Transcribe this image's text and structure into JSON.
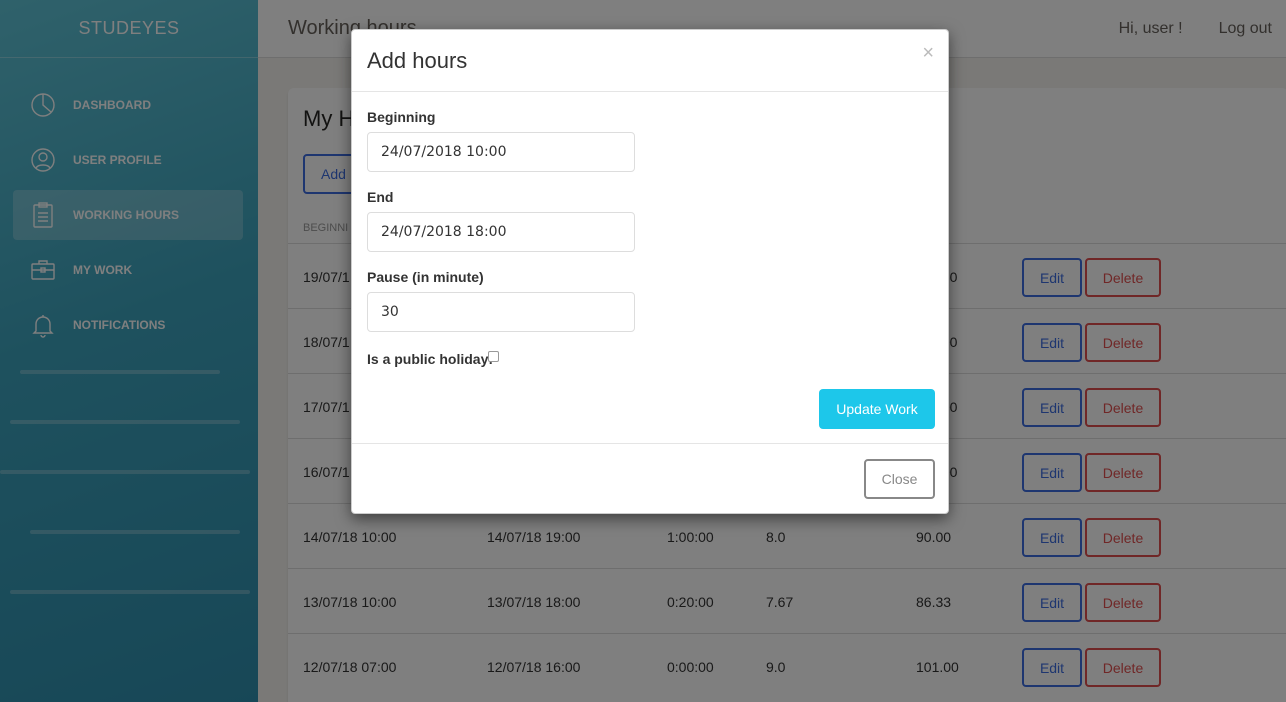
{
  "brand": "STUDEYES",
  "nav": [
    {
      "label": "DASHBOARD",
      "icon": "pie-chart-icon"
    },
    {
      "label": "USER PROFILE",
      "icon": "user-icon"
    },
    {
      "label": "WORKING HOURS",
      "icon": "clipboard-icon"
    },
    {
      "label": "MY WORK",
      "icon": "briefcase-icon"
    },
    {
      "label": "NOTIFICATIONS",
      "icon": "bell-icon"
    }
  ],
  "topbar": {
    "title": "Working hours",
    "greeting": "Hi, user !",
    "logout": "Log out"
  },
  "card": {
    "title": "My H",
    "add_label": "Add",
    "headers": [
      "BEGINNI",
      "RY"
    ],
    "rows": [
      {
        "begin": "19/07/1",
        "end": "",
        "pause": "",
        "hours": "",
        "salary": ".50"
      },
      {
        "begin": "18/07/1",
        "end": "",
        "pause": "",
        "hours": "",
        "salary": ".00"
      },
      {
        "begin": "17/07/1",
        "end": "",
        "pause": "",
        "hours": "",
        "salary": ".00"
      },
      {
        "begin": "16/07/1",
        "end": "",
        "pause": "",
        "hours": "",
        "salary": ".00"
      },
      {
        "begin": "14/07/18 10:00",
        "end": "14/07/18 19:00",
        "pause": "1:00:00",
        "hours": "8.0",
        "salary": "90.00"
      },
      {
        "begin": "13/07/18 10:00",
        "end": "13/07/18 18:00",
        "pause": "0:20:00",
        "hours": "7.67",
        "salary": "86.33"
      },
      {
        "begin": "12/07/18 07:00",
        "end": "12/07/18 16:00",
        "pause": "0:00:00",
        "hours": "9.0",
        "salary": "101.00"
      }
    ],
    "edit_label": "Edit",
    "delete_label": "Delete"
  },
  "modal": {
    "title": "Add hours",
    "close_x": "×",
    "beginning_label": "Beginning",
    "beginning_value": "24/07/2018 10:00",
    "end_label": "End",
    "end_value": "24/07/2018 18:00",
    "pause_label": "Pause (in minute)",
    "pause_value": "30",
    "holiday_label": "Is a public holiday:",
    "update_label": "Update Work",
    "close_label": "Close"
  },
  "colors": {
    "primary": "#3d6de0",
    "danger": "#e04f4f",
    "info": "#1dc7ea",
    "sidebar": "#3da3bd"
  }
}
